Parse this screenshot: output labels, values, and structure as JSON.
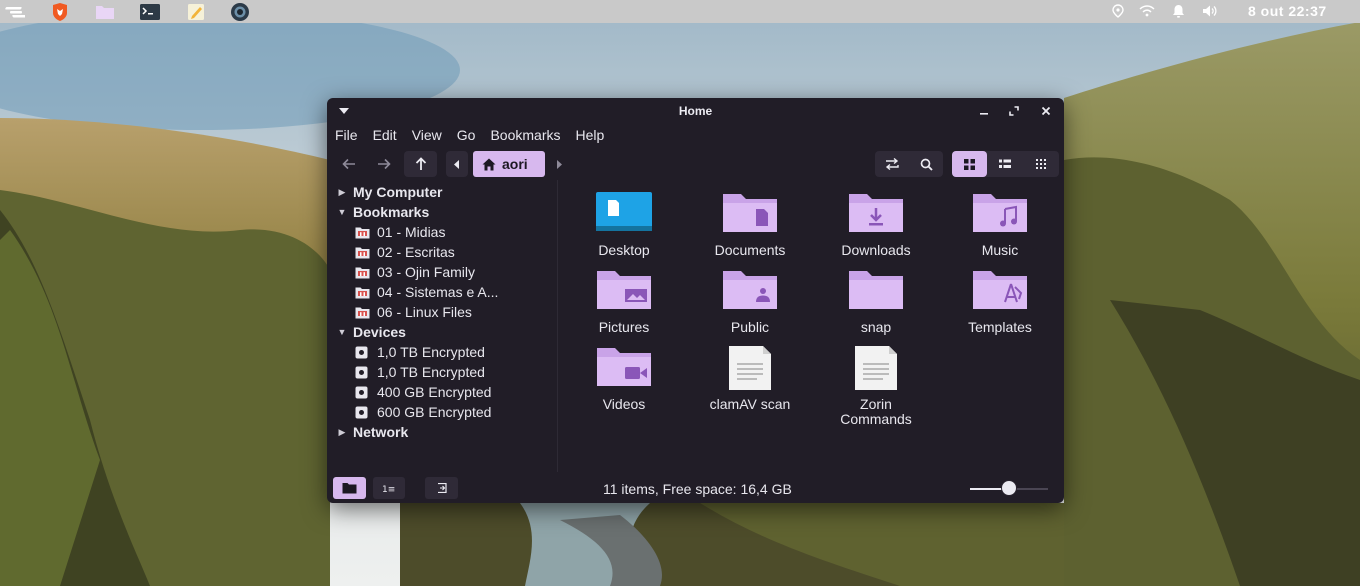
{
  "panel": {
    "apps": [
      {
        "name": "zorin-menu-icon"
      },
      {
        "name": "brave-icon"
      },
      {
        "name": "files-icon"
      },
      {
        "name": "terminal-icon"
      },
      {
        "name": "text-editor-icon"
      },
      {
        "name": "camera-icon"
      }
    ],
    "clock": "8 out 22:37"
  },
  "window": {
    "title": "Home",
    "menu": [
      "File",
      "Edit",
      "View",
      "Go",
      "Bookmarks",
      "Help"
    ],
    "breadcrumb": "aori"
  },
  "sidebar": {
    "sections": [
      {
        "label": "My Computer",
        "expanded": false,
        "items": []
      },
      {
        "label": "Bookmarks",
        "expanded": true,
        "items": [
          "01 - Midias",
          "02 - Escritas",
          "03 - Ojin Family",
          "04 - Sistemas e A...",
          "06 - Linux Files"
        ]
      },
      {
        "label": "Devices",
        "expanded": true,
        "items": [
          "1,0 TB Encrypted",
          "1,0 TB Encrypted",
          "400 GB Encrypted",
          "600 GB Encrypted"
        ]
      },
      {
        "label": "Network",
        "expanded": false,
        "items": []
      }
    ]
  },
  "files": [
    {
      "label": "Desktop",
      "icon": "desktop-folder"
    },
    {
      "label": "Documents",
      "icon": "documents-folder"
    },
    {
      "label": "Downloads",
      "icon": "downloads-folder"
    },
    {
      "label": "Music",
      "icon": "music-folder"
    },
    {
      "label": "Pictures",
      "icon": "pictures-folder"
    },
    {
      "label": "Public",
      "icon": "public-folder"
    },
    {
      "label": "snap",
      "icon": "folder"
    },
    {
      "label": "Templates",
      "icon": "templates-folder"
    },
    {
      "label": "Videos",
      "icon": "videos-folder"
    },
    {
      "label": "clamAV scan",
      "icon": "text-file"
    },
    {
      "label": "Zorin Commands",
      "icon": "text-file"
    }
  ],
  "statusbar": {
    "status": "11 items, Free space: 16,4 GB",
    "zoom_level": 0.5
  },
  "colors": {
    "accent": "#d7b8ee",
    "window_bg": "#211d27",
    "folder": "#d9b8f2",
    "desktop_folder": "#1ea3e6"
  }
}
